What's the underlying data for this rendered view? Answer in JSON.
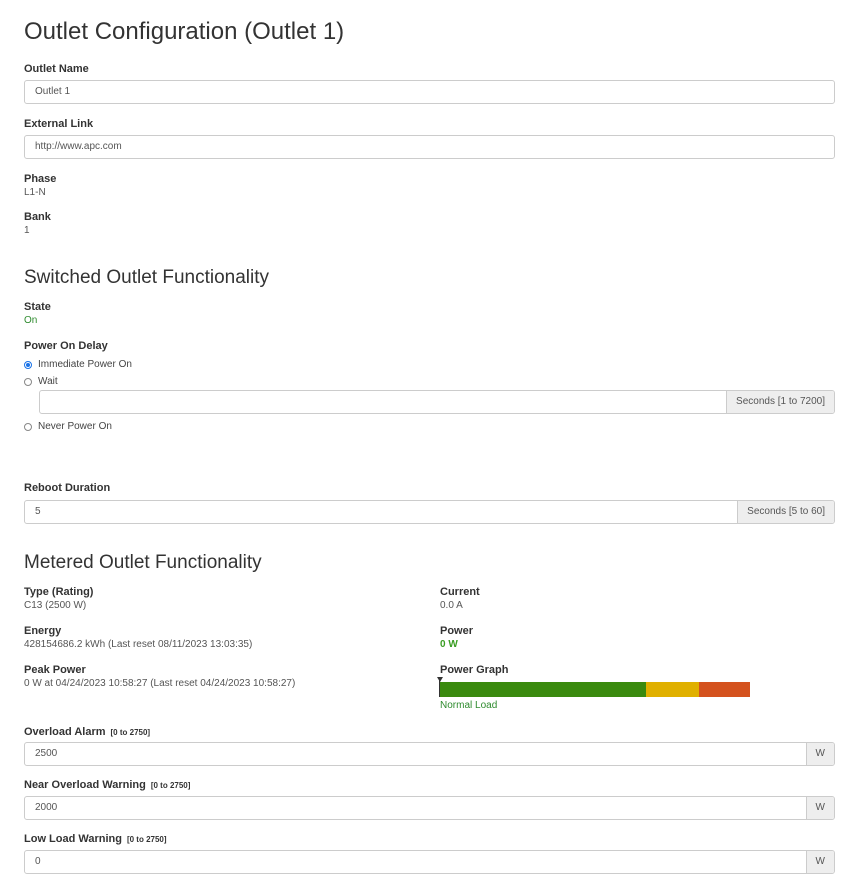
{
  "page": {
    "title": "Outlet Configuration  (Outlet 1)"
  },
  "general": {
    "outlet_name_label": "Outlet Name",
    "outlet_name_value": "Outlet 1",
    "external_link_label": "External Link",
    "external_link_value": "http://www.apc.com",
    "phase_label": "Phase",
    "phase_value": "L1-N",
    "bank_label": "Bank",
    "bank_value": "1"
  },
  "switched": {
    "heading": "Switched Outlet Functionality",
    "state_label": "State",
    "state_value": "On",
    "power_on_delay_label": "Power On Delay",
    "options": [
      {
        "label": "Immediate Power On",
        "checked": true
      },
      {
        "label": "Wait",
        "checked": false
      },
      {
        "label": "Never Power On",
        "checked": false
      }
    ],
    "wait_value": "",
    "wait_unit": "Seconds [1 to 7200]",
    "reboot_label": "Reboot Duration",
    "reboot_value": "5",
    "reboot_unit": "Seconds [5 to 60]"
  },
  "metered": {
    "heading": "Metered Outlet Functionality",
    "type_label": "Type (Rating)",
    "type_value": "C13 (2500 W)",
    "current_label": "Current",
    "current_value": "0.0 A",
    "energy_label": "Energy",
    "energy_value": "428154686.2 kWh (Last reset 08/11/2023 13:03:35)",
    "power_label": "Power",
    "power_value": "0 W",
    "peak_label": "Peak Power",
    "peak_value": "0 W at 04/24/2023 10:58:27 (Last reset 04/24/2023 10:58:27)",
    "graph_label": "Power Graph",
    "graph_status": "Normal Load",
    "graph_level": 0,
    "graph_segments": [
      {
        "fraction": 0.665,
        "color": "#3a8a0e"
      },
      {
        "fraction": 0.17,
        "color": "#e0b000"
      },
      {
        "fraction": 0.165,
        "color": "#d4521e"
      }
    ],
    "overload_label": "Overload Alarm",
    "overload_hint": "[0 to 2750]",
    "overload_value": "2500",
    "near_label": "Near Overload Warning",
    "near_hint": "[0 to 2750]",
    "near_value": "2000",
    "low_label": "Low Load Warning",
    "low_hint": "[0 to 2750]",
    "low_value": "0",
    "unit_w": "W"
  }
}
